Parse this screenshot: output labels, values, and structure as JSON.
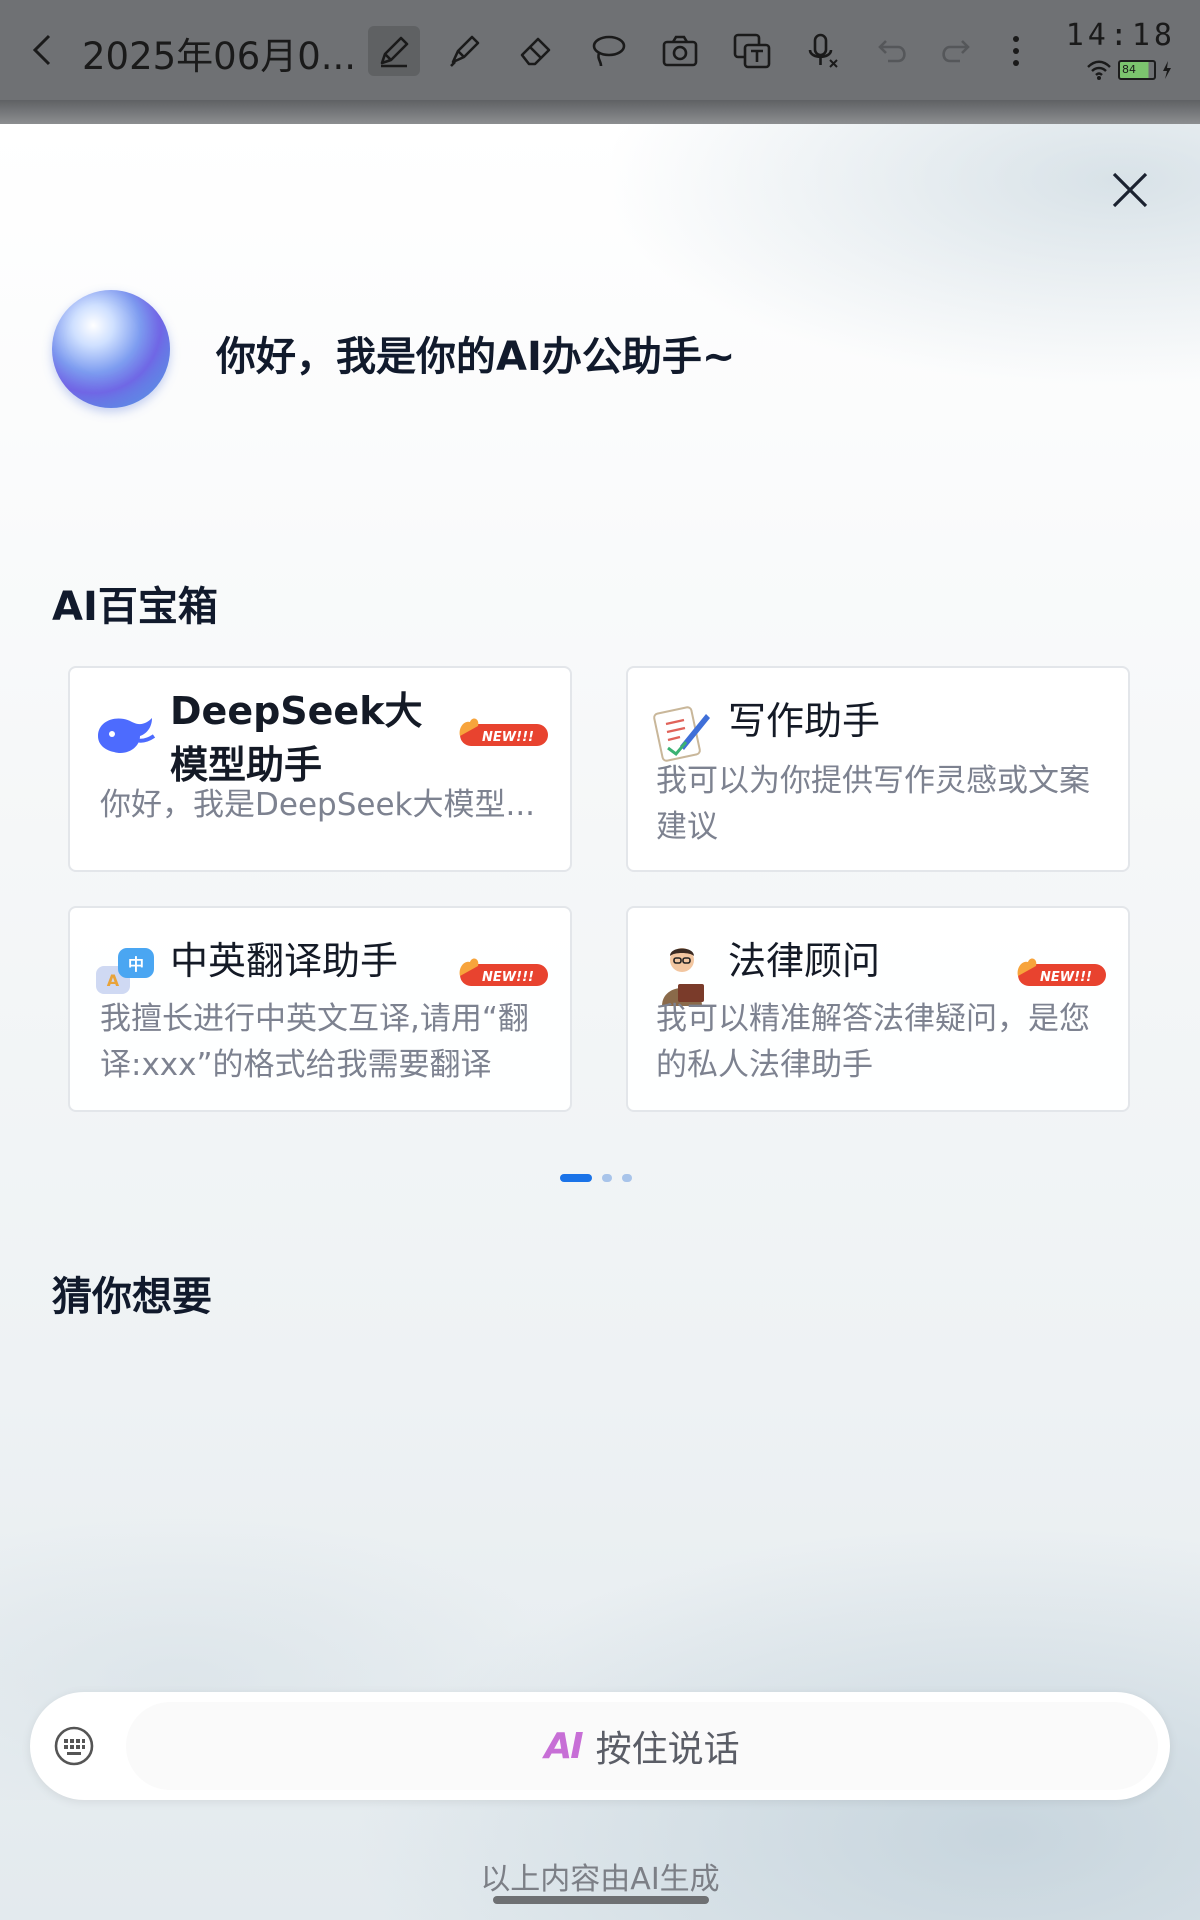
{
  "toolbar": {
    "title": "2025年06月0...",
    "tools": [
      "pen-icon",
      "highlighter-icon",
      "eraser-icon",
      "lasso-icon",
      "camera-icon",
      "text-box-icon",
      "voice-input-icon",
      "undo-icon",
      "redo-icon",
      "more-icon"
    ]
  },
  "status_bar": {
    "time": "14:18",
    "battery": "84"
  },
  "assistant": {
    "greeting": "你好，我是你的AI办公助手~"
  },
  "toolbox": {
    "title": "AI百宝箱",
    "cards": [
      {
        "name": "DeepSeek大模型助手",
        "desc": "你好，我是DeepSeek大模型...",
        "badge": "NEW!!!"
      },
      {
        "name": "写作助手",
        "desc": "我可以为你提供写作灵感或文案建议"
      },
      {
        "name": "中英翻译助手",
        "desc": "我擅长进行中英文互译,请用“翻译:xxx”的格式给我需要翻译的...",
        "badge": "NEW!!!"
      },
      {
        "name": "法律顾问",
        "desc": "我可以精准解答法律疑问，是您的私人法律助手",
        "badge": "NEW!!!"
      }
    ],
    "page_indicator": {
      "pages": 3,
      "current": 1
    }
  },
  "suggestions": {
    "title": "猜你想要"
  },
  "input": {
    "ai_mark": "AI",
    "hold_to_talk": "按住说话"
  },
  "footer": {
    "note": "以上内容由AI生成"
  },
  "colors": {
    "accent": "#1a73e8",
    "badge": "#e8432f",
    "toolbar": "#6f7174"
  }
}
